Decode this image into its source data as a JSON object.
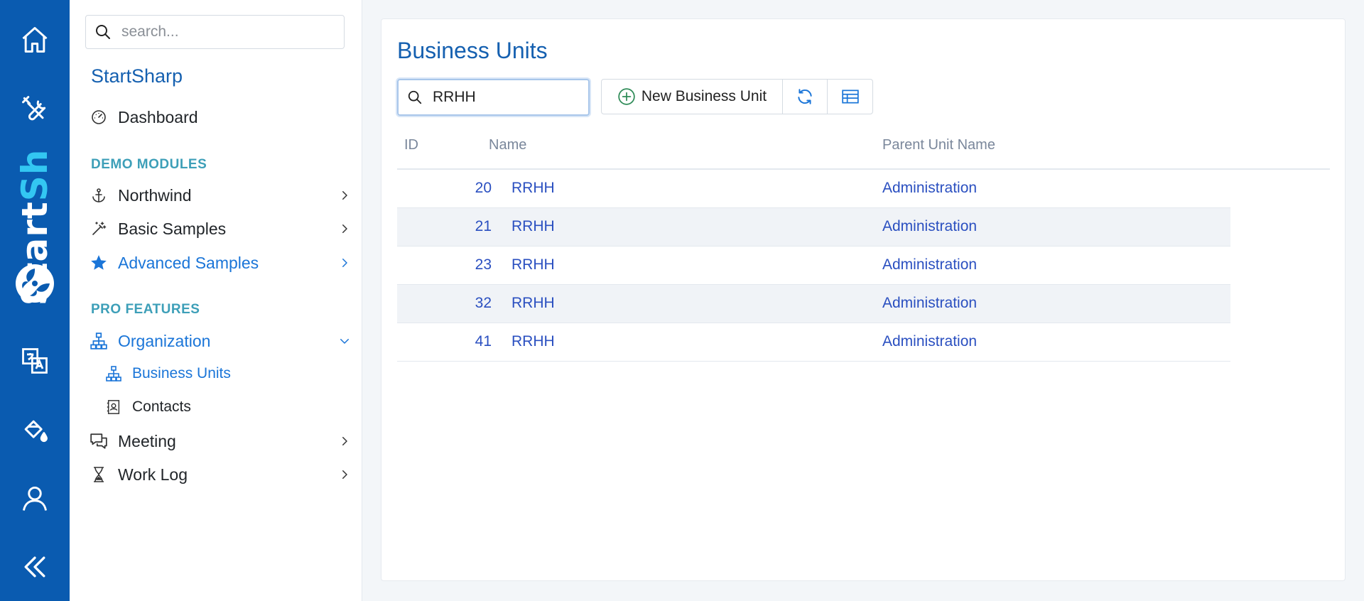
{
  "rail": {
    "brand_part1": "Start",
    "brand_part2": "Sh",
    "icons": [
      "home-icon",
      "tools-icon",
      "translate-icon",
      "theme-icon",
      "user-icon",
      "collapse-icon"
    ]
  },
  "sidebar": {
    "search_placeholder": "search...",
    "app_title": "StartSharp",
    "dashboard": "Dashboard",
    "section_demo": "DEMO MODULES",
    "northwind": "Northwind",
    "basic_samples": "Basic Samples",
    "advanced_samples": "Advanced Samples",
    "section_pro": "PRO FEATURES",
    "organization": "Organization",
    "business_units": "Business Units",
    "contacts": "Contacts",
    "meeting": "Meeting",
    "work_log": "Work Log"
  },
  "main": {
    "title": "Business Units",
    "search_value": "RRHH",
    "new_button": "New Business Unit",
    "columns": {
      "id": "ID",
      "name": "Name",
      "parent": "Parent Unit Name"
    },
    "rows": [
      {
        "id": "20",
        "name": "RRHH",
        "parent": "Administration"
      },
      {
        "id": "21",
        "name": "RRHH",
        "parent": "Administration"
      },
      {
        "id": "23",
        "name": "RRHH",
        "parent": "Administration"
      },
      {
        "id": "32",
        "name": "RRHH",
        "parent": "Administration"
      },
      {
        "id": "41",
        "name": "RRHH",
        "parent": "Administration"
      }
    ]
  },
  "colors": {
    "rail_bg": "#0a5bb0",
    "accent": "#1a75d8",
    "title": "#1560b0",
    "section": "#3d9fb8",
    "link": "#2a4fc0"
  }
}
